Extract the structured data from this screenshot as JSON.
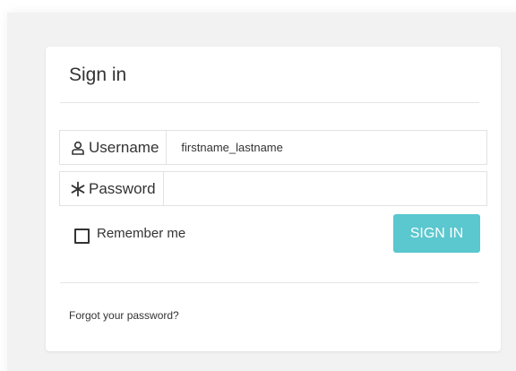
{
  "signin": {
    "title": "Sign in",
    "username": {
      "label": "Username",
      "icon": "user-icon",
      "value": "firstname_lastname"
    },
    "password": {
      "label": "Password",
      "icon": "asterisk-icon",
      "value": ""
    },
    "remember_label": "Remember me",
    "button_label": "SIGN IN",
    "forgot_label": "Forgot your password?"
  },
  "colors": {
    "accent": "#5bc7cf",
    "background": "#f2f2f2",
    "card": "#ffffff",
    "text": "#333333"
  }
}
